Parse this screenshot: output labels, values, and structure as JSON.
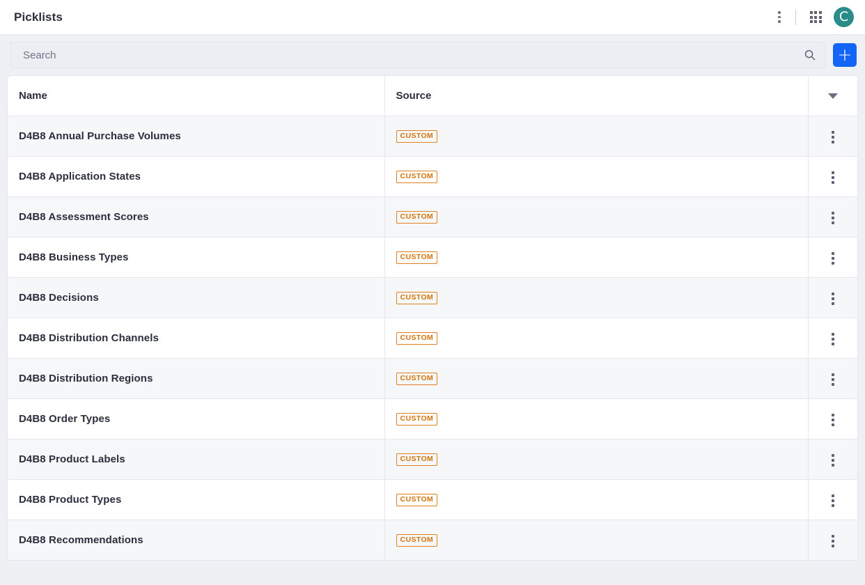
{
  "appbar": {
    "title": "Picklists",
    "menu_icon": "kebab-menu-icon",
    "apps_icon": "apps-grid-icon",
    "avatar_letter": "C",
    "avatar_color": "#2a8b8b"
  },
  "search": {
    "placeholder": "Search",
    "value": "",
    "icon": "search-icon",
    "add_label": "+",
    "add_color": "#1366f5"
  },
  "table": {
    "columns": [
      "Name",
      "Source",
      ""
    ],
    "sort_icon": "chevron-down-icon",
    "row_menu_icon": "kebab-menu-icon",
    "badge_color": "#d1750c",
    "rows": [
      {
        "name": "D4B8 Annual Purchase Volumes",
        "source": "CUSTOM"
      },
      {
        "name": "D4B8 Application States",
        "source": "CUSTOM"
      },
      {
        "name": "D4B8 Assessment Scores",
        "source": "CUSTOM"
      },
      {
        "name": "D4B8 Business Types",
        "source": "CUSTOM"
      },
      {
        "name": "D4B8 Decisions",
        "source": "CUSTOM"
      },
      {
        "name": "D4B8 Distribution Channels",
        "source": "CUSTOM"
      },
      {
        "name": "D4B8 Distribution Regions",
        "source": "CUSTOM"
      },
      {
        "name": "D4B8 Order Types",
        "source": "CUSTOM"
      },
      {
        "name": "D4B8 Product Labels",
        "source": "CUSTOM"
      },
      {
        "name": "D4B8 Product Types",
        "source": "CUSTOM"
      },
      {
        "name": "D4B8 Recommendations",
        "source": "CUSTOM"
      }
    ]
  }
}
